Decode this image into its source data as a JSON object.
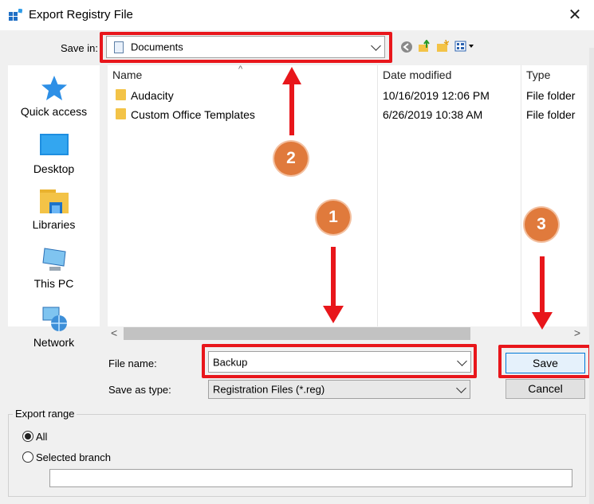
{
  "window": {
    "title": "Export Registry File",
    "close_glyph": "✕"
  },
  "save_in": {
    "label": "Save in:",
    "value": "Documents"
  },
  "toolbar": {
    "icons": [
      "back-icon",
      "up-folder-icon",
      "new-folder-icon",
      "view-menu-icon"
    ]
  },
  "places": [
    {
      "label": "Quick access",
      "icon": "star-icon"
    },
    {
      "label": "Desktop",
      "icon": "desktop-icon"
    },
    {
      "label": "Libraries",
      "icon": "libraries-icon"
    },
    {
      "label": "This PC",
      "icon": "computer-icon"
    },
    {
      "label": "Network",
      "icon": "network-icon"
    }
  ],
  "file_list": {
    "columns": [
      "Name",
      "Date modified",
      "Type"
    ],
    "rows": [
      {
        "name": "Audacity",
        "date": "10/16/2019 12:06 PM",
        "type": "File folder"
      },
      {
        "name": "Custom Office Templates",
        "date": "6/26/2019 10:38 AM",
        "type": "File folder"
      }
    ]
  },
  "file_name": {
    "label": "File name:",
    "value": "Backup"
  },
  "save_as_type": {
    "label": "Save as type:",
    "value": "Registration Files (*.reg)"
  },
  "buttons": {
    "save": "Save",
    "cancel": "Cancel"
  },
  "export_range": {
    "title": "Export range",
    "all_label": "All",
    "branch_label": "Selected branch",
    "branch_value": "",
    "selected": "All"
  },
  "annotations": {
    "badge1": "1",
    "badge2": "2",
    "badge3": "3",
    "highlight_color": "#e8161b",
    "badge_color": "#e07a3c"
  }
}
